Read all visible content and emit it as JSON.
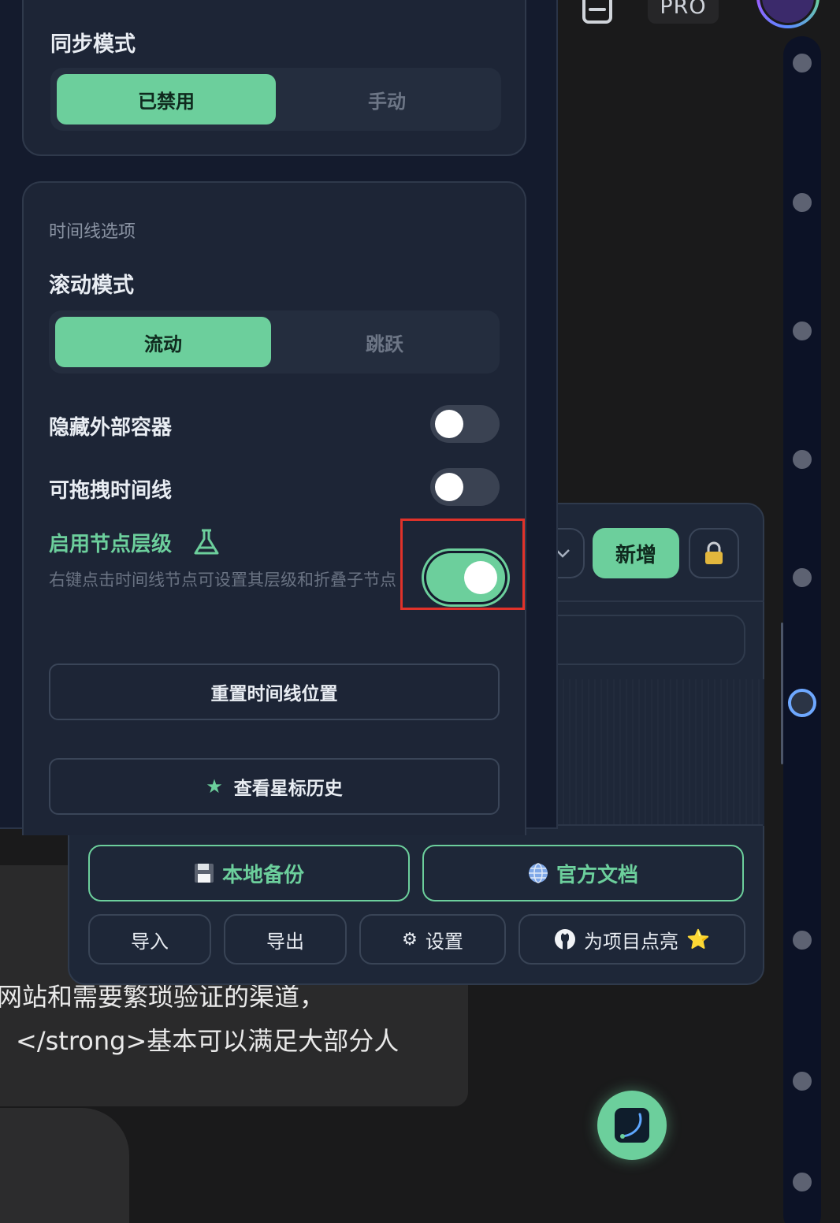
{
  "top_bar": {
    "pro_label": "PRO",
    "inbox_icon": "inbox-icon",
    "avatar_icon": "avatar-icon"
  },
  "background_chat": {
    "line1": "网站和需要繁琐验证的渠道，",
    "line2": "</strong>基本可以满足大部分人"
  },
  "toolbar_panel": {
    "dropdown_icon": "chevron-down-icon",
    "add_label": "新增",
    "lock_icon": "lock-icon",
    "local_backup_label": "本地备份",
    "local_backup_icon": "floppy-disk-icon",
    "docs_label": "官方文档",
    "docs_icon": "globe-icon",
    "import_label": "导入",
    "export_label": "导出",
    "settings_label": "设置",
    "settings_icon": "gear-icon",
    "star_project_label": "为项目点亮",
    "github_icon": "github-icon",
    "star_emoji": "⭐"
  },
  "settings": {
    "sync": {
      "title": "同步模式",
      "options": [
        "已禁用",
        "手动"
      ],
      "selected": "已禁用"
    },
    "timeline": {
      "section_title": "时间线选项",
      "scroll_mode_title": "滚动模式",
      "scroll_options": [
        "流动",
        "跳跃"
      ],
      "scroll_selected": "流动",
      "hide_container_label": "隐藏外部容器",
      "hide_container_on": false,
      "draggable_label": "可拖拽时间线",
      "draggable_on": false,
      "node_level_label": "启用节点层级",
      "node_level_icon": "flask-icon",
      "node_level_desc": "右键点击时间线节点可设置其层级和折叠子节点",
      "node_level_on": true,
      "reset_label": "重置时间线位置",
      "starred_label": "查看星标历史",
      "star_icon": "star-icon"
    }
  },
  "colors": {
    "accent": "#6ccf9c",
    "panel": "#1d2536",
    "highlight": "#e0322a"
  }
}
